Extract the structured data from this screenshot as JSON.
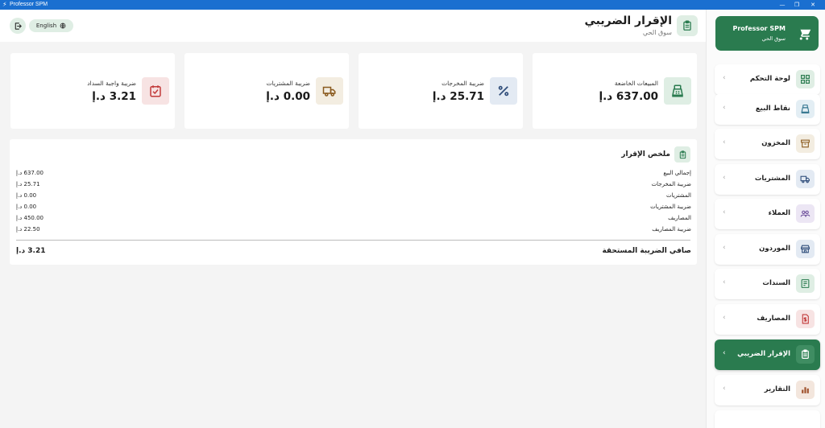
{
  "window": {
    "title": "Professor SPM",
    "minimize": "—",
    "maximize": "❐",
    "close": "✕"
  },
  "header": {
    "title": "الإقرار الضريبي",
    "subtitle": "سوق الحي",
    "language_label": "English"
  },
  "cards": [
    {
      "label": "المبيعات الخاضعة",
      "value": "637.00 د.إ",
      "icon": "cash-register-icon",
      "icon_bg": "#dfeee4",
      "icon_color": "#2a7b4f"
    },
    {
      "label": "ضريبة المخرجات",
      "value": "25.71 د.إ",
      "icon": "percent-icon",
      "icon_bg": "#e3eaf3",
      "icon_color": "#2f4d7a"
    },
    {
      "label": "ضريبة المشتريات",
      "value": "0.00 د.إ",
      "icon": "truck-icon",
      "icon_bg": "#f3ede1",
      "icon_color": "#8a5a1e"
    },
    {
      "label": "ضريبة واجبة السداد",
      "value": "3.21 د.إ",
      "icon": "checkbox-icon",
      "icon_bg": "#f7e3e3",
      "icon_color": "#c23a3a"
    }
  ],
  "summary": {
    "title": "ملخص الإقرار",
    "rows": [
      {
        "label": "إجمالي البيع",
        "value": "637.00 د.إ"
      },
      {
        "label": "ضريبة المخرجات",
        "value": "25.71 د.إ"
      },
      {
        "label": "المشتريات",
        "value": "0.00 د.إ"
      },
      {
        "label": "ضريبة المشتريات",
        "value": "0.00 د.إ"
      },
      {
        "label": "المصاريف",
        "value": "450.00 د.إ"
      },
      {
        "label": "ضريبة المصاريف",
        "value": "22.50 د.إ"
      }
    ],
    "net_label": "صافي الضريبة المستحقة",
    "net_value": "3.21 د.إ"
  },
  "sidebar": {
    "brand_name": "Professor SPM",
    "brand_sub": "سوق الحي",
    "items": [
      {
        "label": "لوحة التحكم",
        "icon": "dashboard-icon",
        "icon_bg": "#dfeee4",
        "icon_color": "#2a7b4f",
        "active": false
      },
      {
        "label": "نقاط البيع",
        "icon": "cash-register-icon",
        "icon_bg": "#e3eef4",
        "icon_color": "#2a6f8a",
        "active": false
      },
      {
        "label": "المخزون",
        "icon": "archive-icon",
        "icon_bg": "#f3ede1",
        "icon_color": "#8a5a1e",
        "active": false
      },
      {
        "label": "المشتريات",
        "icon": "truck-icon",
        "icon_bg": "#e3eaf3",
        "icon_color": "#2f4d7a",
        "active": false
      },
      {
        "label": "العملاء",
        "icon": "users-icon",
        "icon_bg": "#ece6f4",
        "icon_color": "#6b4c9a",
        "active": false
      },
      {
        "label": "الموردون",
        "icon": "store-icon",
        "icon_bg": "#e3eaf3",
        "icon_color": "#2f4d7a",
        "active": false
      },
      {
        "label": "السندات",
        "icon": "receipt-icon",
        "icon_bg": "#dfeee4",
        "icon_color": "#2a7b4f",
        "active": false
      },
      {
        "label": "المصاريف",
        "icon": "expense-icon",
        "icon_bg": "#f7e3e3",
        "icon_color": "#c23a3a",
        "active": false
      },
      {
        "label": "الإقرار الضريبي",
        "icon": "clipboard-icon",
        "icon_bg": "#3f8d62",
        "icon_color": "#ffffff",
        "active": true
      },
      {
        "label": "التقارير",
        "icon": "bar-chart-icon",
        "icon_bg": "#f3e6dd",
        "icon_color": "#a0522d",
        "active": false
      }
    ]
  },
  "colors": {
    "brand": "#2a7b4f",
    "brand_light": "#dfeee4",
    "titlebar": "#1a6fd0"
  }
}
